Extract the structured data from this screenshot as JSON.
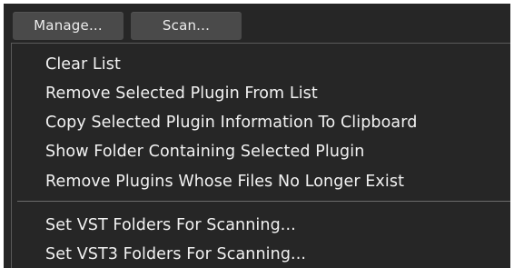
{
  "toolbar": {
    "manage_label": "Manage...",
    "scan_label": "Scan..."
  },
  "menu": {
    "items": [
      {
        "label": "Clear List"
      },
      {
        "label": "Remove Selected Plugin From List"
      },
      {
        "label": "Copy Selected Plugin Information To Clipboard"
      },
      {
        "label": "Show Folder Containing Selected Plugin"
      },
      {
        "label": "Remove Plugins Whose Files No Longer Exist"
      },
      {
        "label": "Set VST Folders For Scanning..."
      },
      {
        "label": "Set VST3 Folders For Scanning..."
      }
    ]
  },
  "colors": {
    "background": "#262626",
    "button": "#4a4a4a",
    "text": "#f2f2f2",
    "separator": "#6a6a6a"
  }
}
